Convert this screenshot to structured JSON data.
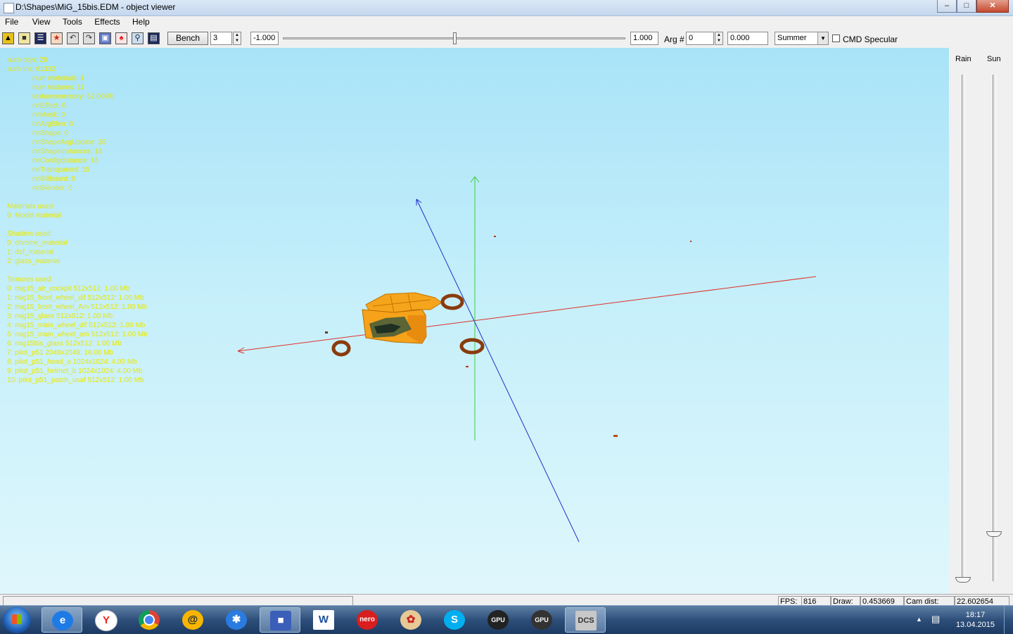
{
  "window": {
    "title": "D:\\Shapes\\MiG_15bis.EDM - object viewer"
  },
  "menu": [
    "File",
    "View",
    "Tools",
    "Effects",
    "Help"
  ],
  "toolbar": {
    "icons": [
      "open-file-icon",
      "save-icon",
      "properties-icon",
      "pilot-icon",
      "undo-icon",
      "redo-icon",
      "render-icon",
      "figure-icon",
      "zoom-icon",
      "document-icon"
    ],
    "bench_label": "Bench",
    "bench_count": "3",
    "slider_min": "-1.000",
    "slider_max": "1.000",
    "slider_position": 0.5,
    "arg_label": "Arg #",
    "arg_value": "0",
    "arg_float": "0.000",
    "season": "Summer",
    "cmd_specular_label": "CMD Specular",
    "cmd_specular_checked": false
  },
  "info_lines": [
    {
      "text": "num objs: 28",
      "indent": false
    },
    {
      "text": "num tris: 61332",
      "indent": false
    },
    {
      "text": "num materials: 1",
      "indent": true
    },
    {
      "text": "num textures: 11",
      "indent": true
    },
    {
      "text": "texturesmemory: 62.00Mb",
      "indent": true
    },
    {
      "text": "nnEffect: 0",
      "indent": true
    },
    {
      "text": "nnMask: 0",
      "indent": true
    },
    {
      "text": "nnArgBlen: 0",
      "indent": true
    },
    {
      "text": "nnShape: 0",
      "indent": true
    },
    {
      "text": "nnShapeArgUpdate: 26",
      "indent": true
    },
    {
      "text": "nnShapeInstances: 16",
      "indent": true
    },
    {
      "text": "nnConfigdistance: 16",
      "indent": true
    },
    {
      "text": "nnTransparent: 15",
      "indent": true
    },
    {
      "text": "nnBillboard: 0",
      "indent": true
    },
    {
      "text": "nnBlender: 0",
      "indent": true
    },
    {
      "text": "",
      "indent": false
    },
    {
      "text": "Materials used:",
      "indent": false
    },
    {
      "text": "0: Model material",
      "indent": false
    },
    {
      "text": "",
      "indent": false
    },
    {
      "text": "Shaders used:",
      "indent": false
    },
    {
      "text": "0: chrome_material",
      "indent": false
    },
    {
      "text": "1: def_material",
      "indent": false
    },
    {
      "text": "2: glass_material",
      "indent": false
    },
    {
      "text": "",
      "indent": false
    },
    {
      "text": "Textures used:",
      "indent": false
    },
    {
      "text": "0: mig15_air_cockpit 512x512: 1.00 Mb",
      "indent": false
    },
    {
      "text": "1: mig15_front_wheel_dif 512x512: 1.00 Mb",
      "indent": false
    },
    {
      "text": "2: mig15_front_wheel_Am 512x512: 1.00 Mb",
      "indent": false
    },
    {
      "text": "3: mig15_glass 512x512: 1.00 Mb",
      "indent": false
    },
    {
      "text": "4: mig15_main_wheel_dif 512x512: 1.00 Mb",
      "indent": false
    },
    {
      "text": "5: mig15_main_wheel_am 512x512: 1.00 Mb",
      "indent": false
    },
    {
      "text": "6: mig15bis_glass 512x512: 1.00 Mb",
      "indent": false
    },
    {
      "text": "7: pilot_p51 2048x2048: 16.00 Mb",
      "indent": false
    },
    {
      "text": "8: pilot_p51_head_a 1024x1024: 4.00 Mb",
      "indent": false
    },
    {
      "text": "9: pilot_p51_helmet_b 1024x1024: 4.00 Mb",
      "indent": false
    },
    {
      "text": "10: pilot_p51_patch_usaf 512x512: 1.00 Mb",
      "indent": false
    }
  ],
  "side_panel": {
    "rain_label": "Rain",
    "sun_label": "Sun",
    "rain_level": 0.0,
    "sun_level": 0.09
  },
  "status": {
    "fps_label": "FPS:",
    "fps_value": "816",
    "draw_label": "Draw:",
    "draw_value": "0.453669",
    "cam_label": "Cam dist:",
    "cam_value": "22.602654"
  },
  "taskbar": {
    "apps": [
      "internet-explorer-icon",
      "yandex-browser-icon",
      "chrome-icon",
      "mail-agent-icon",
      "lightning-app-icon",
      "floppy-save-icon",
      "word-icon",
      "nero-icon",
      "paint-palette-icon",
      "skype-icon",
      "gpu-tweak-icon",
      "gpu-streaming-icon",
      "dcs-icon"
    ],
    "time": "18:17",
    "date": "13.04.2015"
  },
  "colors": {
    "viewport_top": "#a9e3f8",
    "info_text": "#e8e800",
    "axis_x": "#e0302a",
    "axis_y": "#3fcf3f",
    "axis_z": "#2230c8",
    "model_body": "#f5a51c"
  }
}
